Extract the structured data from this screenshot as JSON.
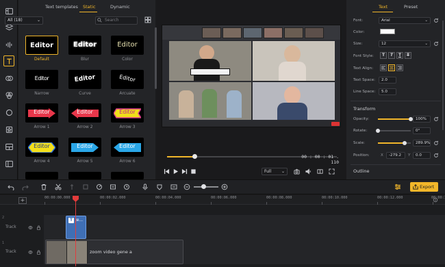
{
  "left_tabs": [
    "Text templates",
    "Static",
    "Dynamic"
  ],
  "filter": {
    "value": "All (18)"
  },
  "search": {
    "placeholder": "Search"
  },
  "templates": [
    {
      "text": "Editor",
      "label": "Default"
    },
    {
      "text": "Editor",
      "label": "Blur"
    },
    {
      "text": "Editor",
      "label": "Color"
    },
    {
      "text": "Editor",
      "label": "Narrow"
    },
    {
      "text": "Editor",
      "label": "Curve"
    },
    {
      "text": "Editor",
      "label": "Arcuate"
    },
    {
      "text": "Editor",
      "label": "Arrow 1"
    },
    {
      "text": "Editor",
      "label": "Arrow 2"
    },
    {
      "text": "Editor",
      "label": "Arrow 3"
    },
    {
      "text": "Editor",
      "label": "Arrow 4"
    },
    {
      "text": "Editor",
      "label": "Arrow 5"
    },
    {
      "text": "Editor",
      "label": "Arrow 6"
    }
  ],
  "player": {
    "timecode": "00 : 00 : 01 . 110",
    "quality": "Full",
    "progress": 0.16
  },
  "right_tabs": [
    "Text",
    "Preset"
  ],
  "props": {
    "font_label": "Font:",
    "font_value": "Arial",
    "color_label": "Color:",
    "color_value": "#ffffff",
    "size_label": "Size:",
    "size_value": "12",
    "font_style_label": "Font Style:",
    "font_style_buttons": [
      "T",
      "T",
      "T",
      "T"
    ],
    "text_align_label": "Text Align:",
    "text_space_label": "Text Space:",
    "text_space_value": "2.0",
    "line_space_label": "Line Space:",
    "line_space_value": "5.0",
    "transform_title": "Transform",
    "opacity_label": "Opacity:",
    "opacity_value": "100%",
    "opacity_level": 1.0,
    "rotate_label": "Rotate:",
    "rotate_value": "0°",
    "rotate_level": 0.0,
    "scale_label": "Scale:",
    "scale_value": "289.9%",
    "scale_level": 0.82,
    "position_label": "Position:",
    "position_x_label": "X",
    "position_x": "-279.2",
    "position_y_label": "Y",
    "position_y": "0.0",
    "outline_title": "Outline"
  },
  "toolbar": {
    "export_label": "Export",
    "zoom_level": 0.4
  },
  "timeline": {
    "ruler": [
      "00:00:00.000",
      "00:00:02.000",
      "00:00:04.000",
      "00:00:06.000",
      "00:00:08.000",
      "00:00:10.000",
      "00:00:12.000",
      "00:00:14.000"
    ],
    "tracks": [
      {
        "num": "2",
        "label": "Track"
      },
      {
        "num": "1",
        "label": "Track"
      }
    ],
    "text_clip_label": "Je...",
    "video_clip_label": "zoom video gene a"
  },
  "colors": {
    "accent": "#f1b62a",
    "clip_blue": "#3f6fb5",
    "playhead": "#e23b3b"
  }
}
